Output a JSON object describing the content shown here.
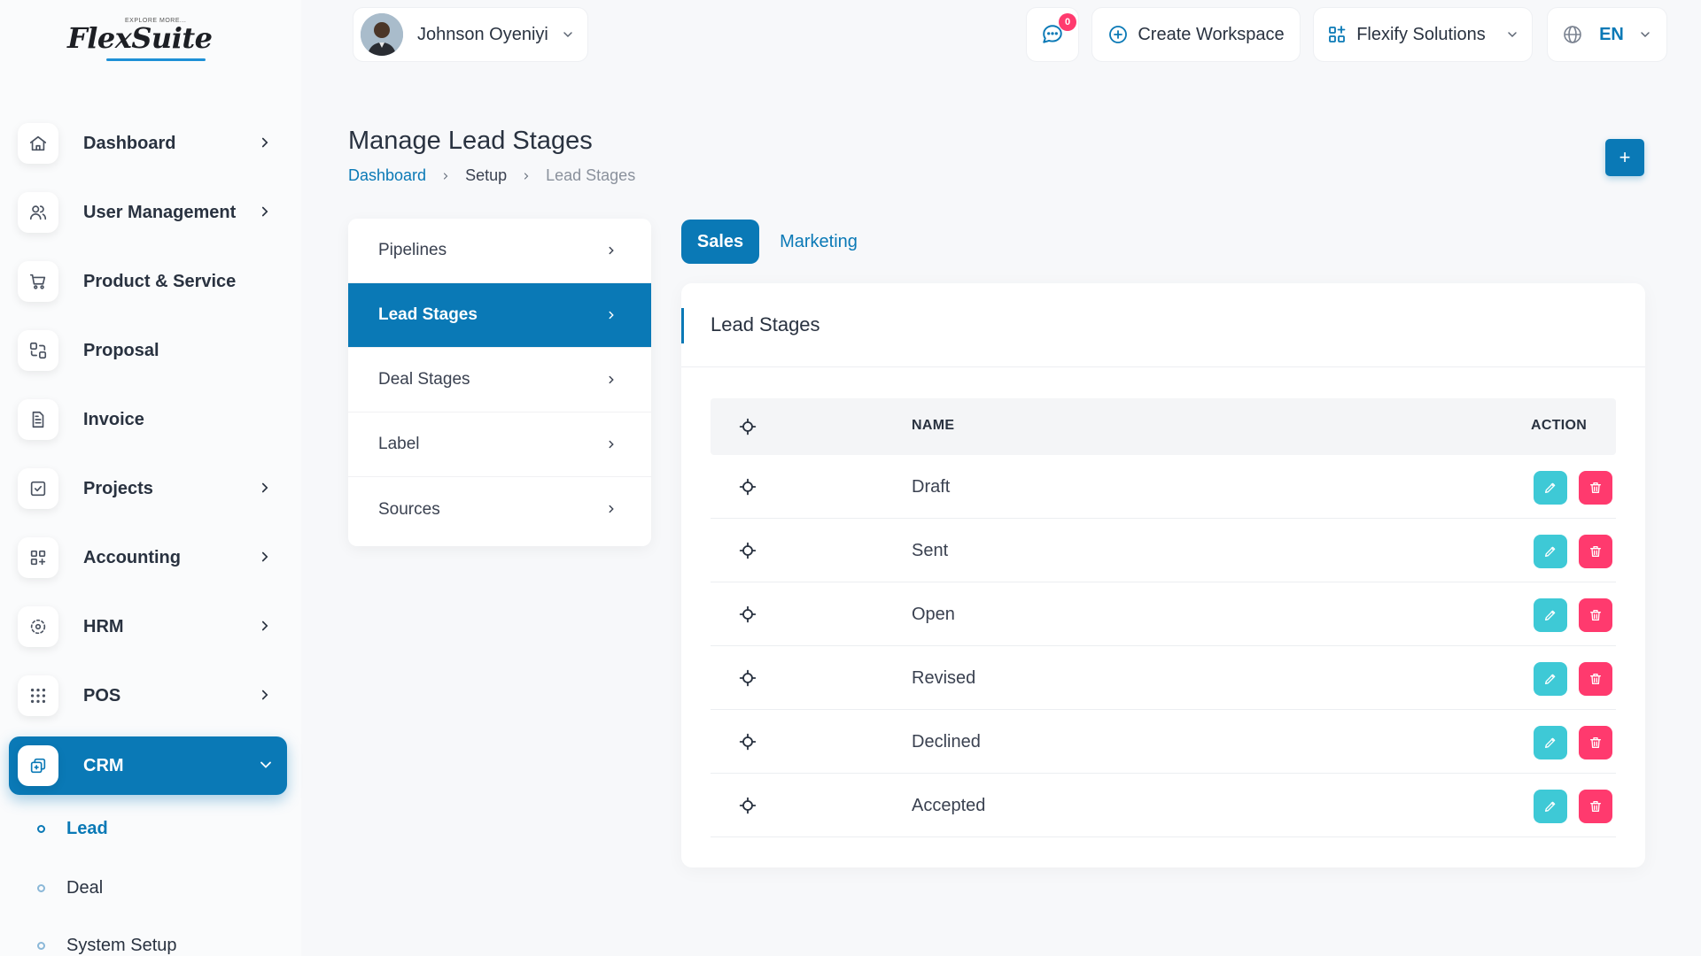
{
  "app": {
    "logo_text": "FlexSuite",
    "logo_tagline": "EXPLORE MORE..."
  },
  "header": {
    "user_name": "Johnson Oyeniyi",
    "notifications_count": "0",
    "create_workspace_label": "Create Workspace",
    "company_label": "Flexify Solutions",
    "language_label": "EN"
  },
  "sidebar": {
    "items": [
      {
        "label": "Dashboard",
        "icon": "home-icon",
        "has_chevron": true
      },
      {
        "label": "User Management",
        "icon": "users-icon",
        "has_chevron": true
      },
      {
        "label": "Product & Service",
        "icon": "cart-icon",
        "has_chevron": false
      },
      {
        "label": "Proposal",
        "icon": "proposal-icon",
        "has_chevron": false
      },
      {
        "label": "Invoice",
        "icon": "invoice-icon",
        "has_chevron": false
      },
      {
        "label": "Projects",
        "icon": "projects-icon",
        "has_chevron": true
      },
      {
        "label": "Accounting",
        "icon": "accounting-icon",
        "has_chevron": true
      },
      {
        "label": "HRM",
        "icon": "hrm-icon",
        "has_chevron": true
      },
      {
        "label": "POS",
        "icon": "pos-icon",
        "has_chevron": true
      },
      {
        "label": "CRM",
        "icon": "crm-icon",
        "has_chevron": true,
        "active": true
      }
    ],
    "crm_sub_items": [
      {
        "label": "Lead",
        "active": true
      },
      {
        "label": "Deal",
        "active": false
      },
      {
        "label": "System Setup",
        "active": false
      }
    ]
  },
  "page": {
    "title": "Manage Lead Stages",
    "breadcrumb": [
      "Dashboard",
      "Setup",
      "Lead Stages"
    ],
    "add_button_label": "+"
  },
  "settings_menu": {
    "items": [
      {
        "label": "Pipelines",
        "active": false
      },
      {
        "label": "Lead Stages",
        "active": true
      },
      {
        "label": "Deal Stages",
        "active": false
      },
      {
        "label": "Label",
        "active": false
      },
      {
        "label": "Sources",
        "active": false
      }
    ]
  },
  "tabs": [
    {
      "label": "Sales",
      "active": true
    },
    {
      "label": "Marketing",
      "active": false
    }
  ],
  "card": {
    "title": "Lead Stages",
    "columns": {
      "name": "NAME",
      "action": "ACTION"
    },
    "rows": [
      {
        "name": "Draft"
      },
      {
        "name": "Sent"
      },
      {
        "name": "Open"
      },
      {
        "name": "Revised"
      },
      {
        "name": "Declined"
      },
      {
        "name": "Accepted"
      }
    ]
  },
  "colors": {
    "primary": "#0a79b6",
    "edit": "#3ec9d6",
    "delete": "#ff3a6e"
  }
}
